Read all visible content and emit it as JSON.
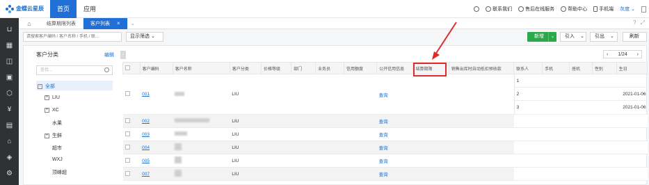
{
  "topbar": {
    "logo_text": "金蝶云星辰",
    "nav_home": "首页",
    "nav_app": "应用",
    "contact": "联系我们",
    "after_sales": "售后在线服务",
    "help": "帮助中心",
    "phone": "手机端",
    "user": "灰度"
  },
  "tabs": {
    "items": [
      {
        "label": "结算期限列表"
      },
      {
        "label": "客户列表"
      }
    ]
  },
  "toolbar": {
    "search_placeholder": "请搜索客户编码 / 客户名称 / 手机 / 联...",
    "filter_label": "显示筛选",
    "new_label": "新增",
    "import_label": "引入",
    "export_label": "引出",
    "refresh_label": "刷新"
  },
  "category": {
    "title": "客户分类",
    "edit": "编辑",
    "search_placeholder": "查找...",
    "tree": [
      {
        "label": "全部",
        "mark": "-"
      },
      {
        "label": "LIU",
        "mark": "+"
      },
      {
        "label": "XC",
        "mark": "+"
      },
      {
        "label": "水果",
        "mark": ""
      },
      {
        "label": "生鲜",
        "mark": "+"
      },
      {
        "label": "超市",
        "mark": ""
      },
      {
        "label": "WXJ",
        "mark": ""
      },
      {
        "label": "顶峰超",
        "mark": ""
      }
    ]
  },
  "pager": {
    "text": "1/24"
  },
  "table": {
    "headers": [
      "客户编码",
      "客户名称",
      "客户分类",
      "价格等级",
      "部门",
      "业务员",
      "信用额度",
      "公开信用信息",
      "结算期限",
      "销售出库时自动抵扣预收款",
      "联系人",
      "手机",
      "座机",
      "性别",
      "生日"
    ],
    "rows": [
      {
        "code": "001",
        "category": "LIU",
        "credit": "查询"
      },
      {
        "code": "002",
        "category": "LIU",
        "credit": "查询"
      },
      {
        "code": "003",
        "category": "LIU",
        "credit": "查询"
      },
      {
        "code": "004",
        "category": "LIU",
        "credit": "查询"
      },
      {
        "code": "005",
        "category": "LIU",
        "credit": "查询"
      },
      {
        "code": "007",
        "category": "LIU",
        "credit": "查询"
      }
    ],
    "contacts": [
      {
        "num": "1",
        "birthday": ""
      },
      {
        "num": "2",
        "birthday": "2021-01-06"
      },
      {
        "num": "3",
        "birthday": "2021-01-06"
      }
    ]
  },
  "colors": {
    "brand_blue": "#1f6fd6",
    "new_green": "#2aa94a",
    "highlight_red": "#e02b2b"
  }
}
